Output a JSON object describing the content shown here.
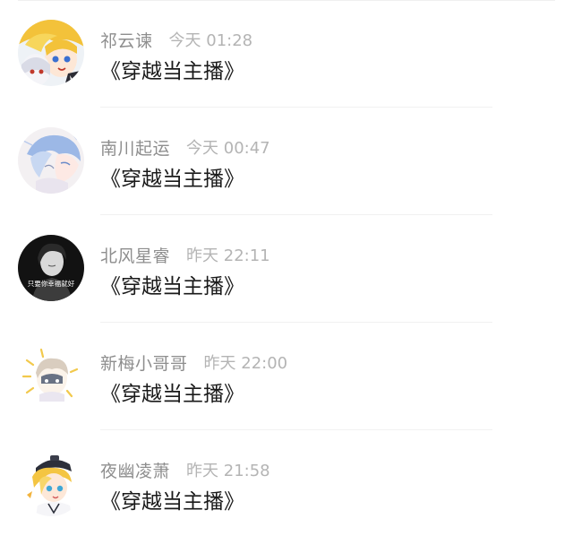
{
  "comments": [
    {
      "username": "祁云谏",
      "time": "今天 01:28",
      "message": "《穿越当主播》",
      "avatar_icon": "anime-blonde-avatar-icon"
    },
    {
      "username": "南川起运",
      "time": "今天 00:47",
      "message": "《穿越当主播》",
      "avatar_icon": "anime-bluehair-avatar-icon"
    },
    {
      "username": "北风星睿",
      "time": "昨天 22:11",
      "message": "《穿越当主播》",
      "avatar_icon": "bw-portrait-avatar-icon",
      "avatar_caption": "只要你幸福就好"
    },
    {
      "username": "新梅小哥哥",
      "time": "昨天 22:00",
      "message": "《穿越当主播》",
      "avatar_icon": "anime-sun-avatar-icon"
    },
    {
      "username": "夜幽凌萧",
      "time": "昨天 21:58",
      "message": "《穿越当主播》",
      "avatar_icon": "anime-hat-avatar-icon"
    }
  ]
}
